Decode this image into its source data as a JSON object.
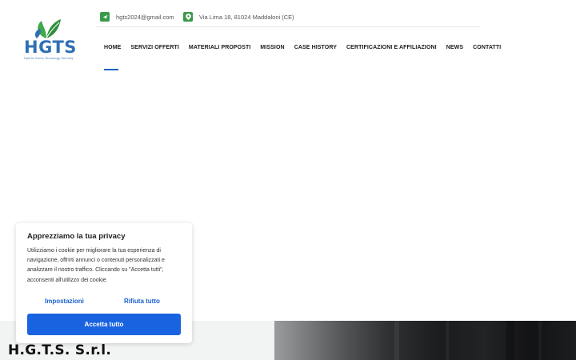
{
  "logo": {
    "letters": "HGTS",
    "tagline": "Hybrid Green Tecnology Security",
    "icon": "leaf-logo-icon",
    "colors": {
      "blue": "#2f6fb5",
      "green": "#3fa84a"
    }
  },
  "contact": {
    "email": "hgts2024@gmail.com",
    "email_icon": "send-arrow-icon",
    "address": "Via Lima 18, 81024 Maddaloni (CE)",
    "address_icon": "map-pin-icon",
    "icon_color": "#3a9a4a"
  },
  "nav": {
    "active": "HOME",
    "accent": "#1e63c9",
    "items": [
      {
        "label": "HOME"
      },
      {
        "label": "SERVIZI OFFERTI"
      },
      {
        "label": "MATERIALI PROPOSTI"
      },
      {
        "label": "MISSION"
      },
      {
        "label": "CASE HISTORY"
      },
      {
        "label": "CERTIFICAZIONI E AFFILIAZIONI"
      },
      {
        "label": "NEWS"
      },
      {
        "label": "CONTATTI"
      }
    ]
  },
  "company": {
    "title": "H.G.T.S. S.r.l."
  },
  "cookie": {
    "title": "Apprezziamo la tua privacy",
    "text": "Utilizziamo i cookie per migliorare la tua esperienza di navigazione, offrirti annunci o contenuti personalizzati e analizzare il nostro traffico. Cliccando su \"Accetta tutti\", acconsenti all'utilizzo dei cookie.",
    "settings_label": "Impostazioni",
    "reject_label": "Rifiuta tutto",
    "accept_label": "Accetta tutto",
    "accent": "#1a63e0"
  }
}
